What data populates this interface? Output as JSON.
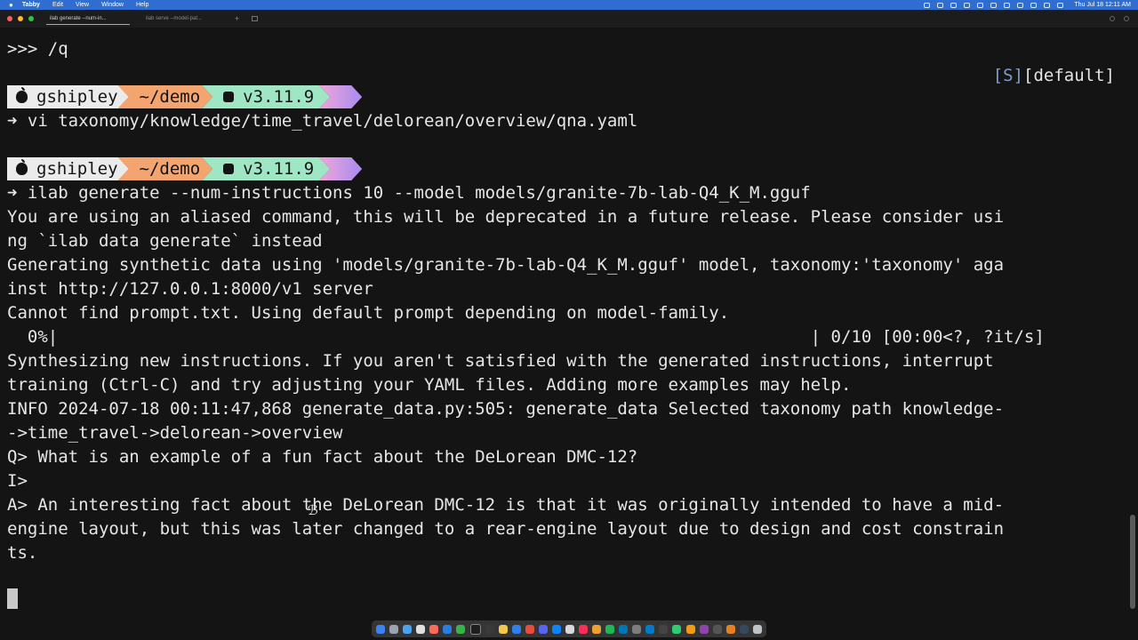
{
  "menubar": {
    "apple": "",
    "app_name": "Tabby",
    "menus": [
      "Edit",
      "View",
      "Window",
      "Help"
    ],
    "clock": "Thu Jul 18  12:11 AM"
  },
  "tabs": [
    {
      "label": "ilab generate --num-in..."
    },
    {
      "label": "ilab serve --model-pat..."
    }
  ],
  "tab_add": "+",
  "status": {
    "s": "[S]",
    "profile": "[default]"
  },
  "prompt": {
    "user": "gshipley",
    "dir": "~/demo",
    "python": "v3.11.9"
  },
  "terminal": {
    "line_q": ">>> /q",
    "cmd1": "➜ vi taxonomy/knowledge/time_travel/delorean/overview/qna.yaml",
    "cmd2": "➜ ilab generate --num-instructions 10 --model models/granite-7b-lab-Q4_K_M.gguf",
    "out": [
      "You are using an aliased command, this will be deprecated in a future release. Please consider usi",
      "ng `ilab data generate` instead",
      "Generating synthetic data using 'models/granite-7b-lab-Q4_K_M.gguf' model, taxonomy:'taxonomy' aga",
      "inst http://127.0.0.1:8000/v1 server",
      "Cannot find prompt.txt. Using default prompt depending on model-family.",
      "  0%|                                                                          | 0/10 [00:00<?, ?it/s]",
      "Synthesizing new instructions. If you aren't satisfied with the generated instructions, interrupt",
      "training (Ctrl-C) and try adjusting your YAML files. Adding more examples may help.",
      "INFO 2024-07-18 00:11:47,868 generate_data.py:505: generate_data Selected taxonomy path knowledge-",
      "->time_travel->delorean->overview",
      "Q> What is an example of a fun fact about the DeLorean DMC-12?",
      "I>",
      "A> An interesting fact about the DeLorean DMC-12 is that it was originally intended to have a mid-",
      "engine layout, but this was later changed to a rear-engine layout due to design and cost constrain",
      "ts."
    ]
  },
  "colors": {
    "menubar_bg": "#2f6ed0",
    "terminal_bg": "#141414",
    "seg_user": "#ebebeb",
    "seg_dir": "#f3a46f",
    "seg_python": "#9fe6c4",
    "seg_end": "#a78cf0"
  }
}
